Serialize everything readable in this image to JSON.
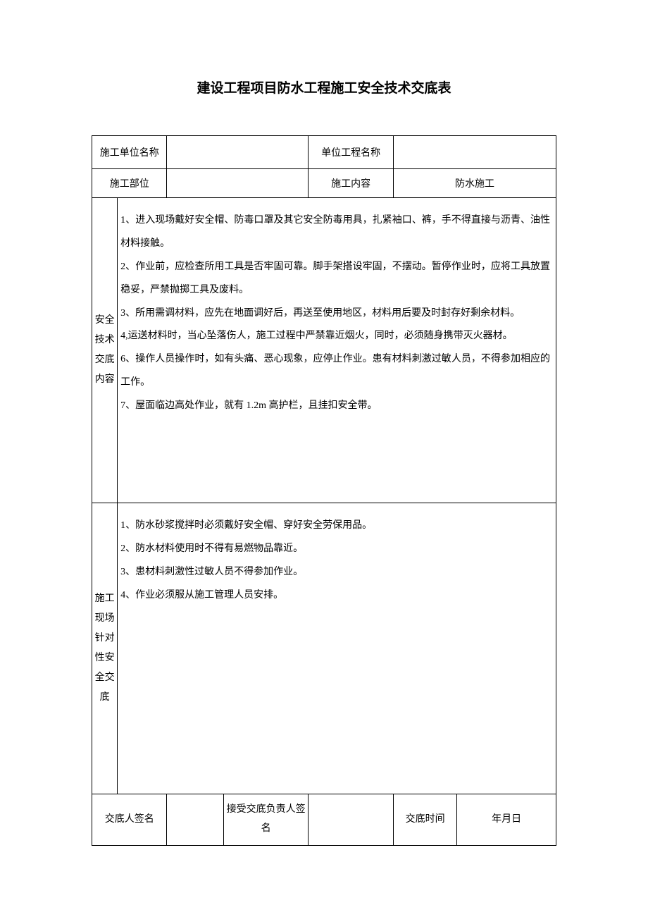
{
  "title": "建设工程项目防水工程施工安全技术交底表",
  "header": {
    "unit_name_label": "施工单位名称",
    "unit_name_value": "",
    "proj_name_label": "单位工程名称",
    "proj_name_value": "",
    "part_label": "施工部位",
    "part_value": "",
    "content_label": "施工内容",
    "content_value": "防水施工"
  },
  "safety": {
    "label": "安全技术交底内容",
    "text": "1、进入现场戴好安全帽、防毒口罩及其它安全防毒用具，扎紧袖口、裤，手不得直接与沥青、油性材料接触。\n2、作业前，应检查所用工具是否牢固可靠。脚手架搭设牢固，不摆动。暂停作业时，应将工具放置稳妥，严禁抛掷工具及废料。\n3、所用需调材料，应先在地面调好后，再送至使用地区，材料用后要及时封存好剩余材料。\n4,运送材料时，当心坠落伤人，施工过程中严禁靠近烟火，同时，必须随身携带灭火器材。\n6、操作人员操作时，如有头痛、恶心现象，应停止作业。患有材料刺激过敏人员，不得参加相应的工作。\n7、屋面临边高处作业，就有 1.2m 高护栏，且挂扣安全带。"
  },
  "site": {
    "label": "施工现场针对性安全交底",
    "text": "1、防水砂浆搅拌时必须戴好安全帽、穿好安全劳保用品。\n2、防水材料使用时不得有易燃物品靠近。\n3、患材料刺激性过敏人员不得参加作业。\n4、作业必须服从施工管理人员安排。"
  },
  "signature": {
    "signer_label": "交底人签名",
    "signer_value": "",
    "receiver_label": "接受交底负责人签名",
    "receiver_value": "",
    "time_label": "交底时间",
    "time_value": "年月日"
  }
}
